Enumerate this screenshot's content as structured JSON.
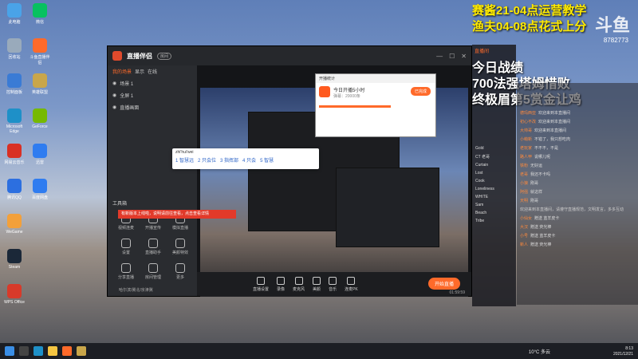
{
  "overlay": {
    "top_lines": [
      "赛酱21-04点运营教学",
      "渔夫04-08点花式上分"
    ],
    "logo": "斗鱼",
    "room_number": "8782773",
    "big_lines": [
      "今日战绩",
      "700法强塔姆惜败",
      "终极眉第5赏金让鸡"
    ]
  },
  "desktop_icons": [
    {
      "label": "此电脑",
      "color": "#4aa3e8"
    },
    {
      "label": "回收站",
      "color": "#9ab"
    },
    {
      "label": "控制面板",
      "color": "#3a7bd5"
    },
    {
      "label": "Microsoft Edge",
      "color": "#1e90c8"
    },
    {
      "label": "网易云音乐",
      "color": "#d93025"
    },
    {
      "label": "腾讯QQ",
      "color": "#2c6fe0"
    },
    {
      "label": "WeGame",
      "color": "#f3a03a"
    },
    {
      "label": "Steam",
      "color": "#1b2838"
    },
    {
      "label": "WPS Office",
      "color": "#d83a2a"
    },
    {
      "label": "微信",
      "color": "#07c160"
    },
    {
      "label": "斗鱼直播伴侣",
      "color": "#ff6a2a"
    },
    {
      "label": "英雄联盟",
      "color": "#c9a64a"
    },
    {
      "label": "GeForce",
      "color": "#76b900"
    },
    {
      "label": "迅雷",
      "color": "#2f7cf0"
    },
    {
      "label": "百度网盘",
      "color": "#2f7cf0"
    }
  ],
  "streamer_app": {
    "title": "直播伴侣",
    "badge": "房间",
    "scene_tabs": [
      "我的场景",
      "显示",
      "在线"
    ],
    "scenes": [
      "场景 1",
      "全屏 1",
      "直播画面"
    ],
    "tools_title": "工具箱",
    "tools": [
      "视频连麦",
      "开播宣传",
      "模拟直播",
      "设置",
      "直播助手",
      "美颜特效",
      "分享直播",
      "房间管理",
      "更多"
    ],
    "notice": "有新版本上线啦，说明请前往查看，点击查看详情",
    "bottom_hint": "哈尔滨/冀北/京津冀",
    "bottom_buttons": [
      "直播设置",
      "录像",
      "麦克风",
      "美颜",
      "音乐",
      "连麦PK"
    ],
    "start_button": "开始直播",
    "timer": "01:59:59"
  },
  "stream_stats": {
    "title": "开播统计",
    "line1": "今日开播5小时",
    "line2": "弹幕：20000条",
    "button": "已完成"
  },
  "search_popup": {
    "query": "zhi'hui'wei",
    "candidates": [
      "1 智慧远",
      "2 只会位",
      "3 指挥部",
      "4 只会",
      "5 智慧"
    ]
  },
  "chat": {
    "tab": "直播间",
    "room_users": [
      "Gold",
      "CT 老哥",
      "Curtain",
      "Lost",
      "Cook",
      "Loneliness",
      "WHITE",
      "Sam",
      "Beach",
      "Tribe"
    ]
  },
  "danmu": [
    {
      "name": "德玛西亚",
      "text": "欢迎来到本直播间"
    },
    {
      "name": "初心不改",
      "text": "欢迎来到本直播间"
    },
    {
      "name": "大帅哥",
      "text": "欢迎来到本直播间"
    },
    {
      "name": "小萌新",
      "text": "不错了，我只想吃肉"
    },
    {
      "name": "老玩家",
      "text": "不不不，不是"
    },
    {
      "name": "路人甲",
      "text": "说哪儿呢"
    },
    {
      "name": "铁粉",
      "text": "无好运"
    },
    {
      "name": "老哥",
      "text": "我还不卡吗"
    },
    {
      "name": "小狼",
      "text": "刚哥"
    },
    {
      "name": "阿强",
      "text": "就这样"
    },
    {
      "name": "天明",
      "text": "刚哥"
    }
  ],
  "danmu_notice": "欢迎来到本直播间，请遵守直播规范，文明发言，多多互动",
  "gifts": [
    {
      "name": "小仙女",
      "text": "赠送 蓝羊皮卡"
    },
    {
      "name": "大汉",
      "text": "赠送 荧光棒"
    },
    {
      "name": "小号",
      "text": "赠送 蓝羊皮卡"
    },
    {
      "name": "新人",
      "text": "赠送 荧光棒"
    }
  ],
  "taskbar": {
    "weather": "10°C 多云",
    "time": "8:13",
    "date": "2021/12/21"
  }
}
